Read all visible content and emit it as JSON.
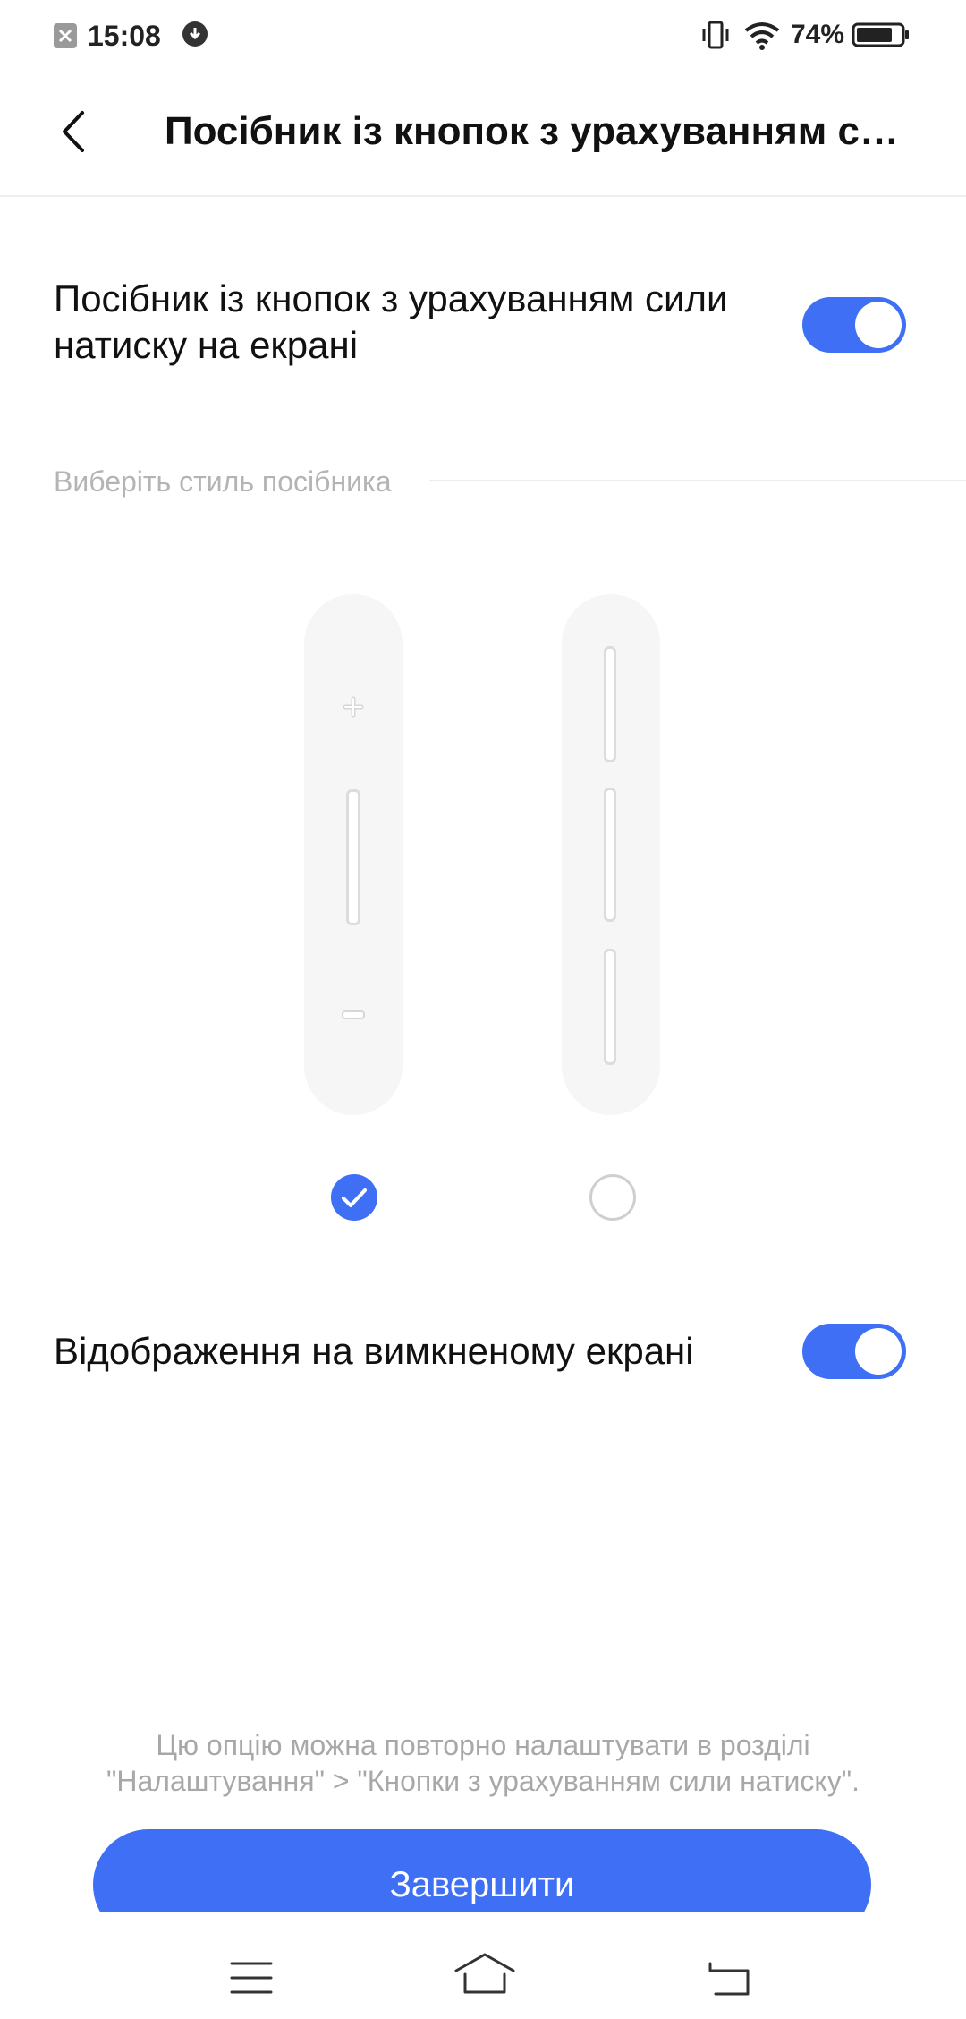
{
  "status_bar": {
    "time": "15:08",
    "battery_percent": "74%",
    "battery_level": 0.74,
    "icons": [
      "notification-close-icon",
      "download-icon",
      "vibrate-icon",
      "wifi-icon",
      "battery-icon"
    ]
  },
  "header": {
    "back_icon": "chevron-left-icon",
    "title": "Посібник із кнопок з урахуванням сил..."
  },
  "settings": {
    "guide_toggle": {
      "label_line1": "Посібник із кнопок з урахуванням сили",
      "label_line2": "натиску на екрані",
      "enabled": true
    },
    "style_section_label": "Виберіть стиль посібника",
    "styles": [
      {
        "id": "style-1",
        "selected": true,
        "icons": [
          "plus-icon",
          "minus-icon"
        ]
      },
      {
        "id": "style-2",
        "selected": false
      }
    ],
    "screen_off_toggle": {
      "label": "Відображення на вимкненому екрані",
      "enabled": true
    }
  },
  "footer": {
    "note_line1": "Цю опцію можна повторно налаштувати в розділі",
    "note_line2": "\"Налаштування\" > \"Кнопки з урахуванням сили натиску\".",
    "finish_label": "Завершити"
  },
  "nav_bar": {
    "icons": [
      "menu-icon",
      "home-icon",
      "back-icon"
    ]
  },
  "colors": {
    "accent": "#3e6ff5",
    "muted_text": "#b4b4b4",
    "background": "#ffffff"
  }
}
